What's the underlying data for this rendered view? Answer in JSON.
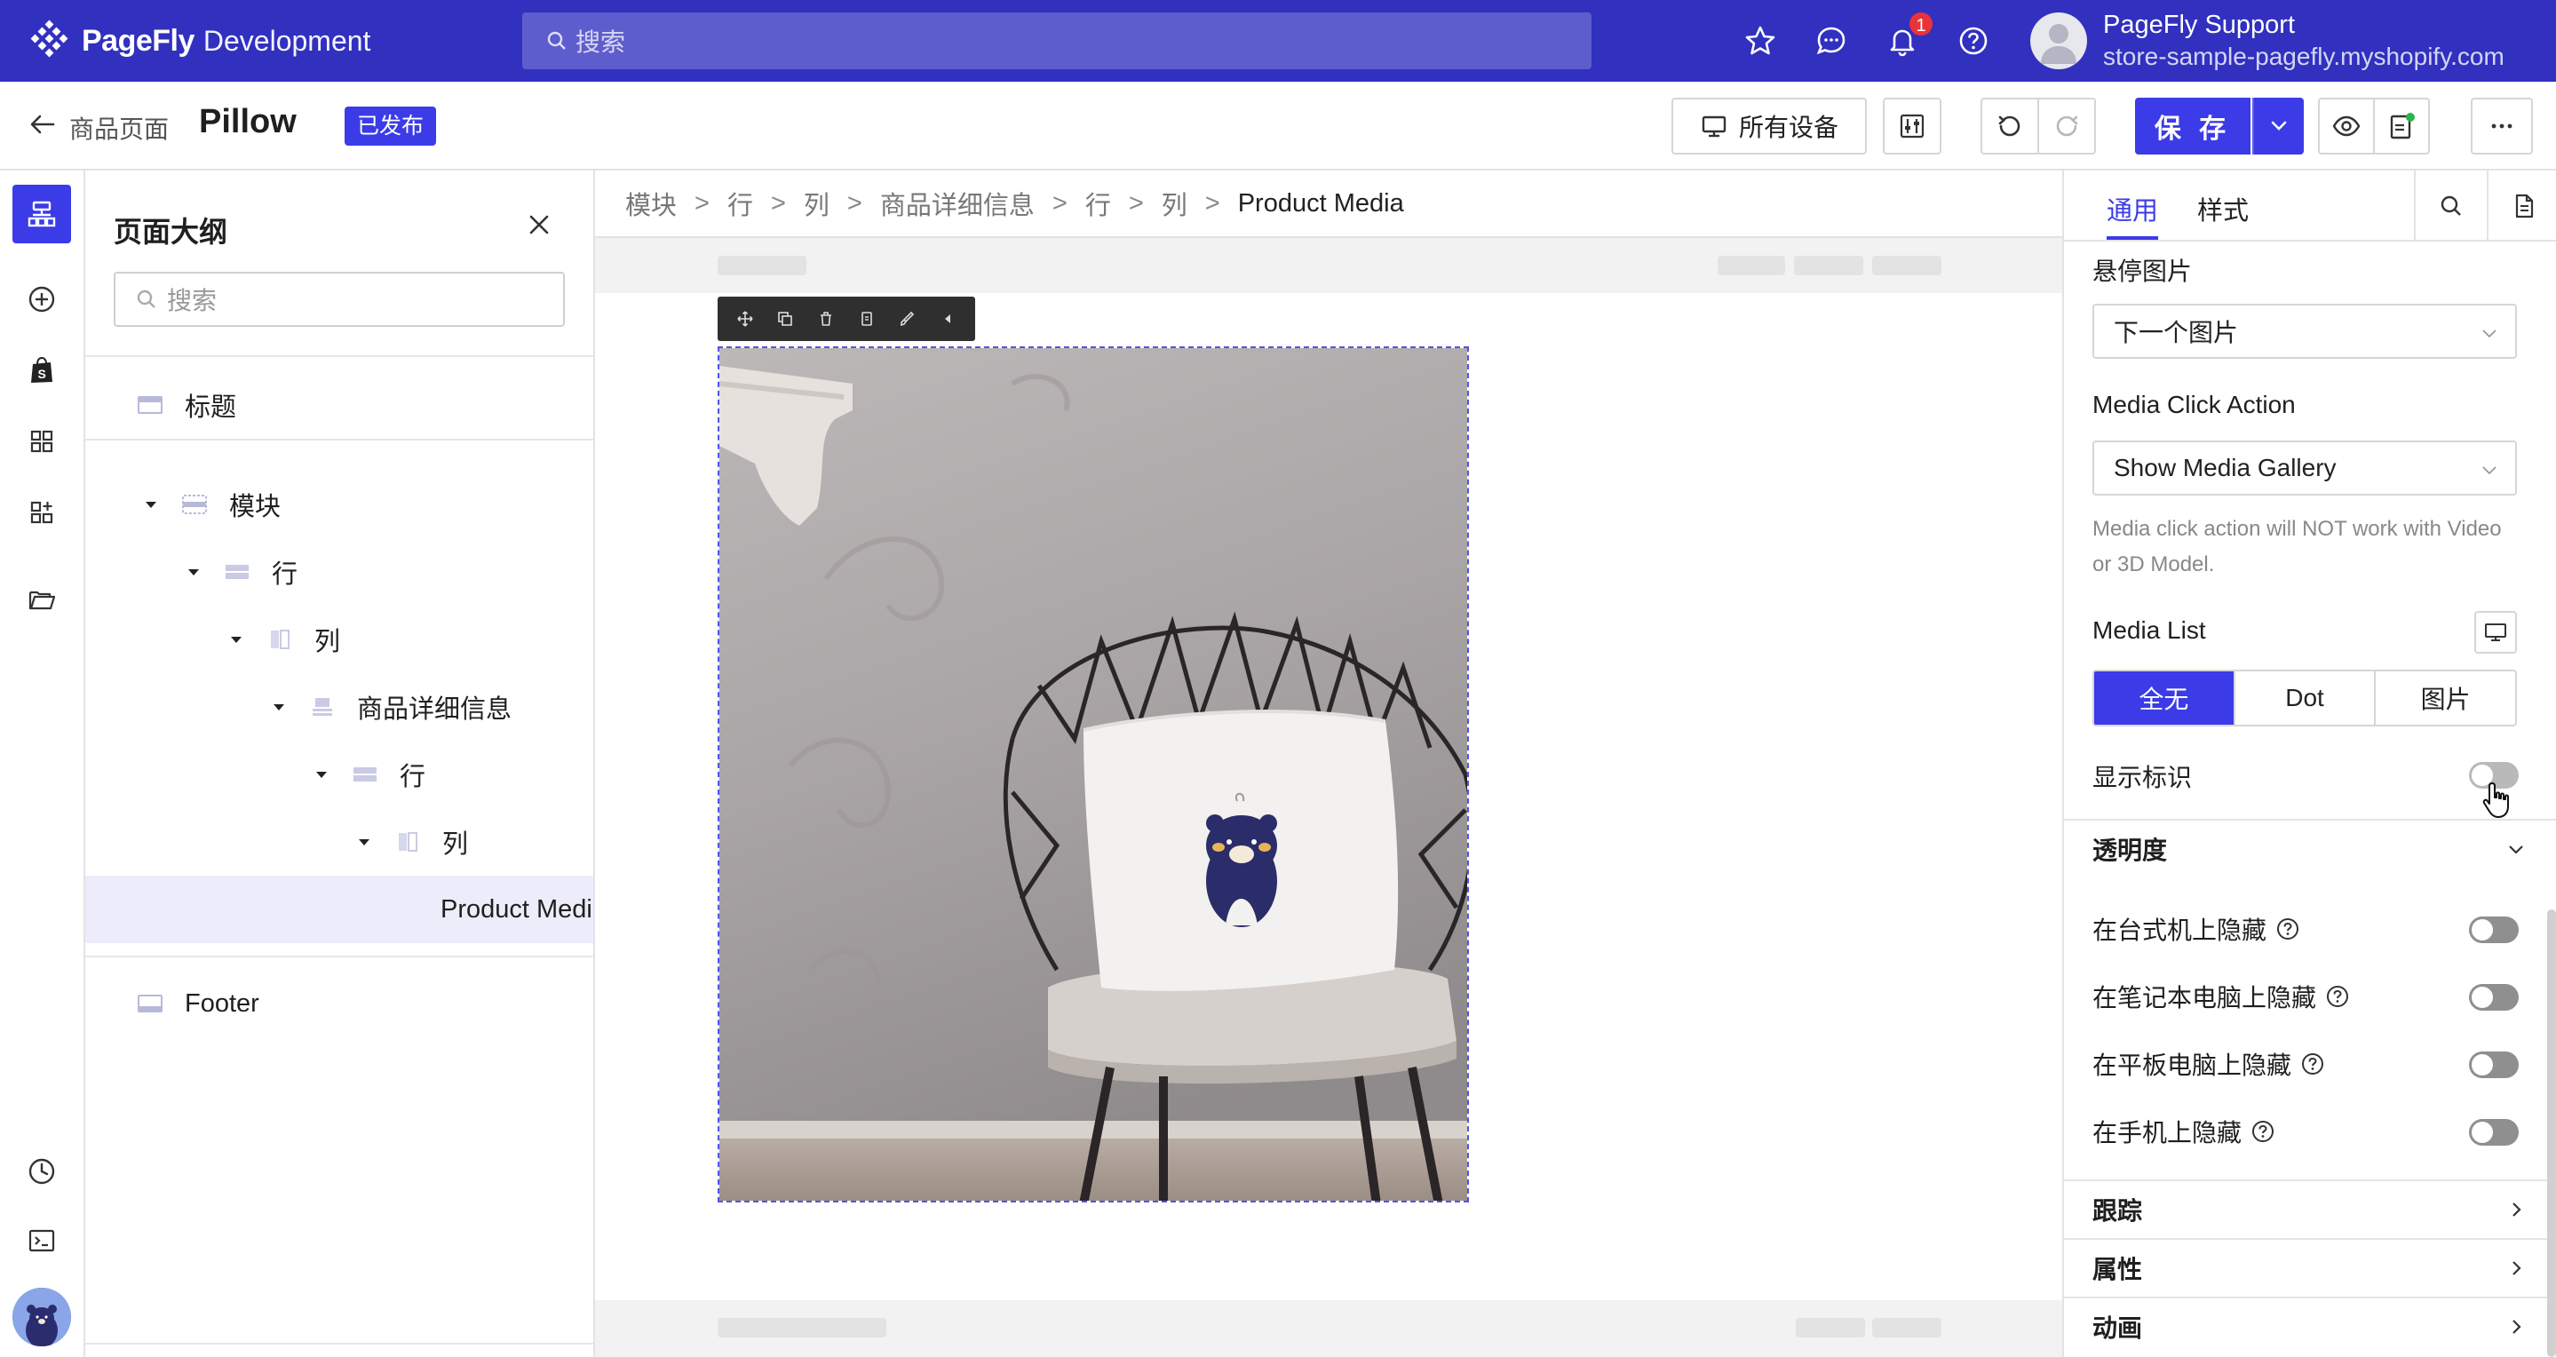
{
  "topbar": {
    "brand": "PageFly",
    "env": "Development",
    "search_placeholder": "搜索",
    "notification_count": "1",
    "user_name": "PageFly Support",
    "user_store": "store-sample-pagefly.myshopify.com",
    "icons": [
      "star-icon",
      "chat-icon",
      "bell-icon",
      "help-icon"
    ]
  },
  "header": {
    "back_label": "商品页面",
    "page_name": "Pillow",
    "status": "已发布",
    "devices_label": "所有设备",
    "save_label": "保 存"
  },
  "outline": {
    "title": "页面大纲",
    "search_placeholder": "搜索",
    "items": [
      {
        "label": "标题"
      },
      {
        "label": "模块"
      },
      {
        "label": "行"
      },
      {
        "label": "列"
      },
      {
        "label": "商品详细信息"
      },
      {
        "label": "行"
      },
      {
        "label": "列"
      },
      {
        "label": "Product Media"
      },
      {
        "label": "Footer"
      }
    ]
  },
  "canvas": {
    "breadcrumb": [
      "模块",
      "行",
      "列",
      "商品详细信息",
      "行",
      "列",
      "Product Media"
    ]
  },
  "inspector": {
    "tabs": [
      "通用",
      "样式"
    ],
    "active_tab": "通用",
    "hover_image_label": "悬停图片",
    "hover_image_value": "下一个图片",
    "click_action_label": "Media Click Action",
    "click_action_value": "Show Media Gallery",
    "click_action_help": "Media click action will NOT work with Video or 3D Model.",
    "media_list_label": "Media List",
    "media_list_options": [
      "全无",
      "Dot",
      "图片"
    ],
    "media_list_selected": "全无",
    "show_badge_label": "显示标识",
    "show_badge_on": false,
    "opacity_section": "透明度",
    "hide_desktop": "在台式机上隐藏",
    "hide_laptop": "在笔记本电脑上隐藏",
    "hide_tablet": "在平板电脑上隐藏",
    "hide_mobile": "在手机上隐藏",
    "tracking_section": "跟踪",
    "attributes_section": "属性",
    "animation_section": "动画"
  },
  "colors": {
    "topbar": "#3130bf",
    "accent": "#3b3be8",
    "badge": "#e8333a",
    "selected_row": "#ececfb"
  }
}
